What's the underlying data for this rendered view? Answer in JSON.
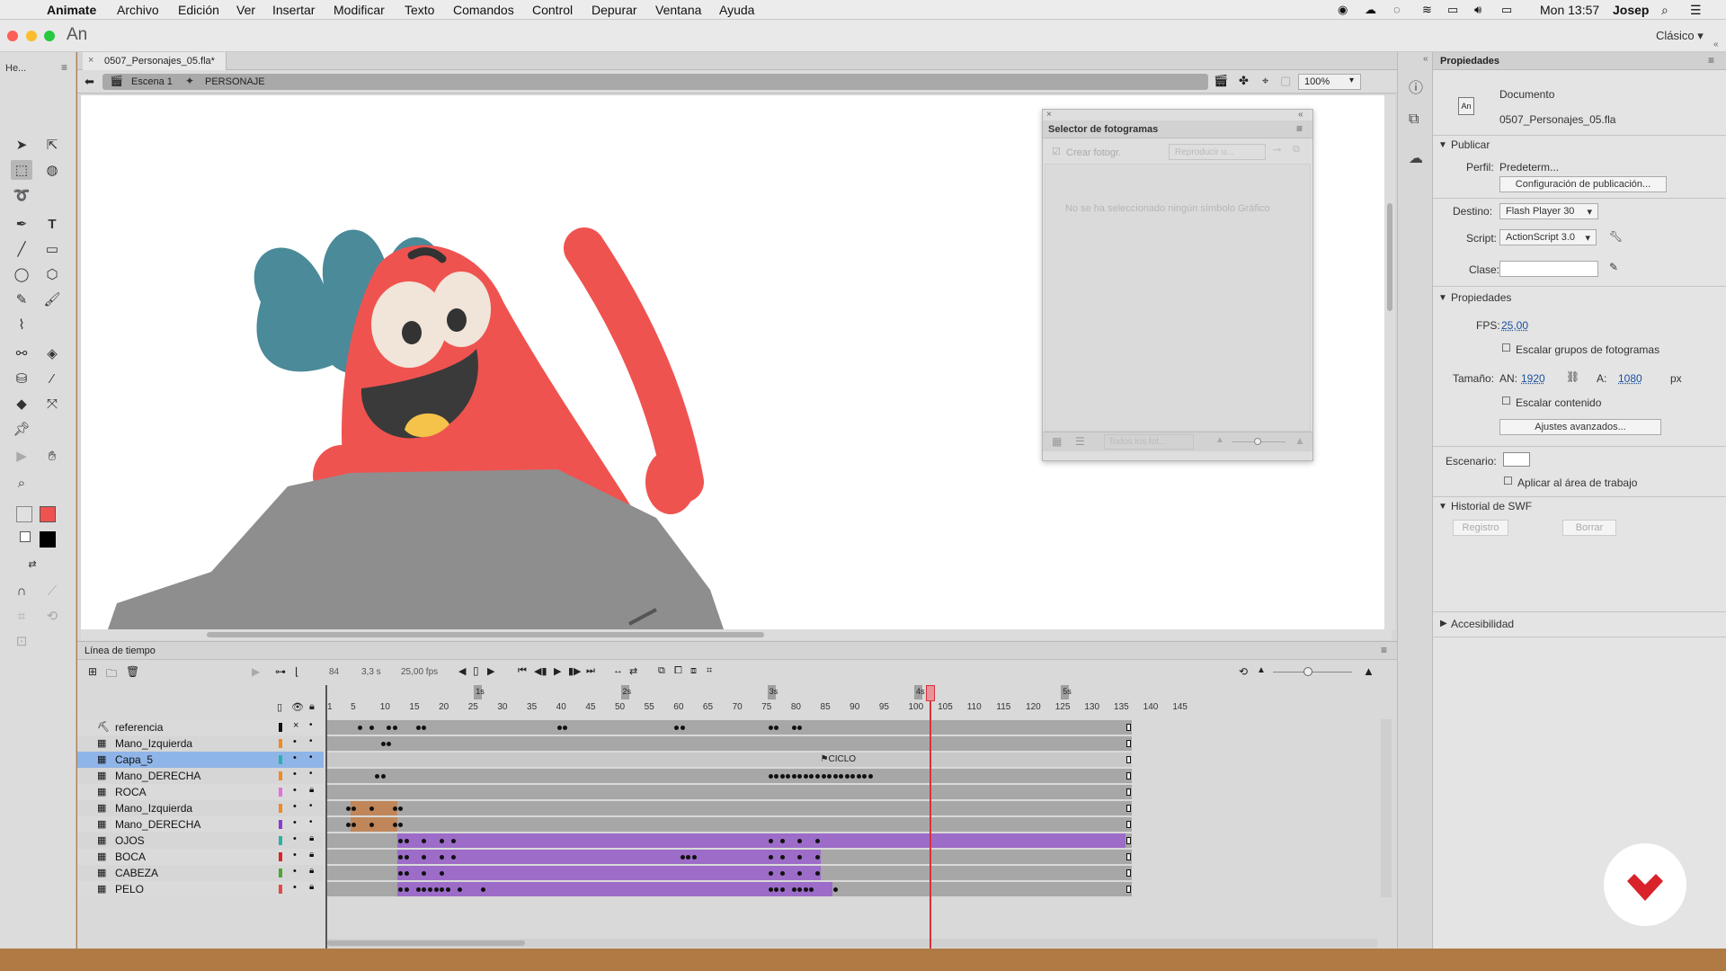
{
  "menubar": {
    "app": "Animate",
    "items": [
      "Archivo",
      "Edición",
      "Ver",
      "Insertar",
      "Modificar",
      "Texto",
      "Comandos",
      "Control",
      "Depurar",
      "Ventana",
      "Ayuda"
    ],
    "clock": "Mon 13:57",
    "user": "Josep"
  },
  "titlebar": {
    "logo": "An",
    "workspace": "Clásico"
  },
  "toolbar": {
    "header": "He..."
  },
  "document": {
    "tab": "0507_Personajes_05.fla*",
    "scene": "Escena 1",
    "symbol": "PERSONAJE",
    "zoom": "100%"
  },
  "frame_picker": {
    "title": "Selector de fotogramas",
    "create_label": "Crear fotogr.",
    "play_label": "Reproducir u...",
    "empty_msg": "No se ha seleccionado ningún símbolo Gráfico",
    "filter": "Todos los fot..."
  },
  "properties": {
    "title": "Propiedades",
    "doc_label": "Documento",
    "doc_icon": "An",
    "doc_name": "0507_Personajes_05.fla",
    "publish_header": "Publicar",
    "profile_label": "Perfil:",
    "profile_value": "Predeterm...",
    "publish_settings": "Configuración de publicación...",
    "target_label": "Destino:",
    "target_value": "Flash Player 30",
    "script_label": "Script:",
    "script_value": "ActionScript 3.0",
    "class_label": "Clase:",
    "props_header": "Propiedades",
    "fps_label": "FPS:",
    "fps_value": "25,00",
    "scale_groups": "Escalar grupos de fotogramas",
    "size_label": "Tamaño:",
    "w_label": "AN:",
    "w_value": "1920",
    "h_label": "A:",
    "h_value": "1080",
    "unit": "px",
    "scale_content": "Escalar contenido",
    "advanced": "Ajustes avanzados...",
    "stage_label": "Escenario:",
    "apply_workarea": "Aplicar al área de trabajo",
    "swf_header": "Historial de SWF",
    "log_btn": "Registro",
    "clear_btn": "Borrar",
    "access_header": "Accesibilidad"
  },
  "timeline": {
    "title": "Línea de tiempo",
    "current_frame": "84",
    "time": "3,3 s",
    "fps": "25,00 fps",
    "ruler_numbers": [
      "1",
      "5",
      "10",
      "15",
      "20",
      "25",
      "30",
      "35",
      "40",
      "45",
      "50",
      "55",
      "60",
      "65",
      "70",
      "75",
      "80",
      "85",
      "90",
      "95",
      "100",
      "105",
      "110",
      "115",
      "120",
      "125",
      "130",
      "135",
      "140",
      "145"
    ],
    "seconds": [
      "1s",
      "2s",
      "3s",
      "4s",
      "5s"
    ],
    "layers": [
      {
        "name": "referencia",
        "color": "#111111"
      },
      {
        "name": "Mano_Izquierda",
        "color": "#f08a24"
      },
      {
        "name": "Capa_5",
        "color": "#2bb1a8",
        "selected": true
      },
      {
        "name": "Mano_DERECHA",
        "color": "#f08a24"
      },
      {
        "name": "ROCA",
        "color": "#e36fe0"
      },
      {
        "name": "Mano_Izquierda",
        "color": "#f08a24"
      },
      {
        "name": "Mano_DERECHA",
        "color": "#8c3cd0"
      },
      {
        "name": "OJOS",
        "color": "#2bb1a8"
      },
      {
        "name": "BOCA",
        "color": "#d9262a"
      },
      {
        "name": "CABEZA",
        "color": "#4aa832"
      },
      {
        "name": "PELO",
        "color": "#e24a4a"
      }
    ],
    "frame_label": "CICLO"
  },
  "colors": {
    "stroke": "#ef5350",
    "fill": "#000000",
    "tween": "#9c6cc8",
    "motion": "#c0865a",
    "playhead": "#d8323c"
  }
}
